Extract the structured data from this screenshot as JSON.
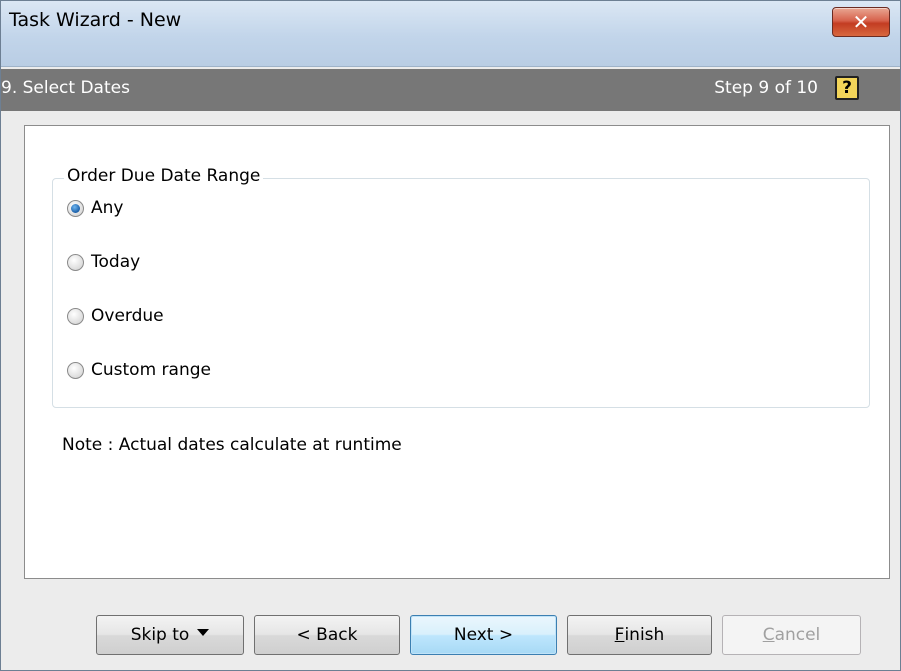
{
  "window": {
    "title": "Task Wizard - New",
    "close_glyph": "✕"
  },
  "stepbar": {
    "title": "9. Select Dates",
    "step_text": "Step 9 of 10",
    "help_glyph": "?"
  },
  "group": {
    "legend": "Order Due Date Range",
    "options": [
      {
        "label": "Any",
        "selected": true
      },
      {
        "label": "Today",
        "selected": false
      },
      {
        "label": "Overdue",
        "selected": false
      },
      {
        "label": "Custom range",
        "selected": false
      }
    ]
  },
  "note": "Note : Actual dates calculate at runtime",
  "buttons": {
    "skip_to": "Skip to",
    "back": "< Back",
    "next": "Next >",
    "finish_mnemonic": "F",
    "finish_rest": "inish",
    "cancel_mnemonic": "C",
    "cancel_rest": "ancel"
  }
}
